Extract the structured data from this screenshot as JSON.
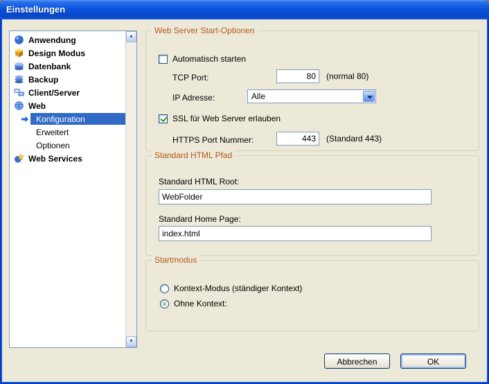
{
  "window": {
    "title": "Einstellungen"
  },
  "sidebar": {
    "items": [
      {
        "label": "Anwendung",
        "icon": "application-icon",
        "level": 1
      },
      {
        "label": "Design Modus",
        "icon": "design-icon",
        "level": 1
      },
      {
        "label": "Datenbank",
        "icon": "database-icon",
        "level": 1
      },
      {
        "label": "Backup",
        "icon": "backup-icon",
        "level": 1
      },
      {
        "label": "Client/Server",
        "icon": "client-server-icon",
        "level": 1
      },
      {
        "label": "Web",
        "icon": "web-icon",
        "level": 1
      },
      {
        "label": "Konfiguration",
        "icon": "selected-arrow-icon",
        "level": 2,
        "selected": true
      },
      {
        "label": "Erweitert",
        "level": 2,
        "selected": false
      },
      {
        "label": "Optionen",
        "level": 2,
        "selected": false
      },
      {
        "label": "Web Services",
        "icon": "web-services-icon",
        "level": 1
      }
    ],
    "scrollbar": {
      "up_glyph": "▲",
      "down_glyph": "▼"
    }
  },
  "groups": {
    "web_server": {
      "title": "Web Server Start-Optionen",
      "autostart_label": "Automatisch starten",
      "autostart_checked": false,
      "tcp_port_label": "TCP Port:",
      "tcp_port_value": "80",
      "tcp_port_hint": "(normal 80)",
      "ip_label": "IP Adresse:",
      "ip_value": "Alle",
      "ssl_label": "SSL für Web Server erlauben",
      "ssl_checked": true,
      "https_label": "HTTPS Port Nummer:",
      "https_value": "443",
      "https_hint": "(Standard 443)"
    },
    "html_path": {
      "title": "Standard HTML Pfad",
      "root_label": "Standard HTML Root:",
      "root_value": "WebFolder",
      "home_label": "Standard Home Page:",
      "home_value": "index.html"
    },
    "startmodus": {
      "title": "Startmodus",
      "context_label": "Kontext-Modus (ständiger Kontext)",
      "context_selected": false,
      "no_context_label": "Ohne Kontext:",
      "no_context_selected": true
    }
  },
  "buttons": {
    "cancel": "Abbrechen",
    "ok": "OK"
  },
  "colors": {
    "titlebar_blue": "#0b53dd",
    "dialog_bg": "#ece9d8",
    "group_title": "#b4591c",
    "selection_blue": "#316ac5",
    "check_green": "#21a121"
  }
}
